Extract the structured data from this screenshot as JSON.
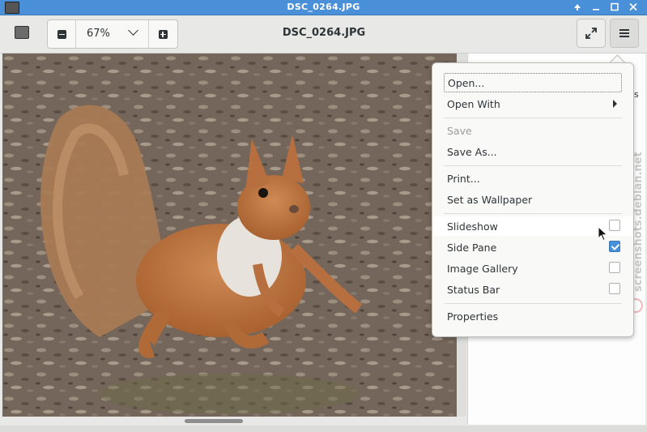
{
  "window": {
    "title": "DSC_0264.JPG",
    "controls": [
      "up-icon",
      "minimize-icon",
      "maximize-icon",
      "close-icon"
    ]
  },
  "toolbar": {
    "zoom_value": "67%",
    "title": "DSC_0264.JPG"
  },
  "menu": {
    "items": [
      {
        "label": "Open..."
      },
      {
        "label": "Open With"
      },
      {
        "label": "Save"
      },
      {
        "label": "Save As..."
      },
      {
        "label": "Print..."
      },
      {
        "label": "Set as Wallpaper"
      },
      {
        "label": "Slideshow",
        "checked": false
      },
      {
        "label": "Side Pane",
        "checked": true
      },
      {
        "label": "Image Gallery",
        "checked": false
      },
      {
        "label": "Status Bar",
        "checked": false
      },
      {
        "label": "Properties"
      }
    ]
  },
  "side_pane": {
    "visible_fragment": "s"
  },
  "watermark": "screenshots.debian.net",
  "colors": {
    "titlebar": "#4a90d9",
    "accent": "#4a90d9",
    "fur": "#b86f3f"
  }
}
